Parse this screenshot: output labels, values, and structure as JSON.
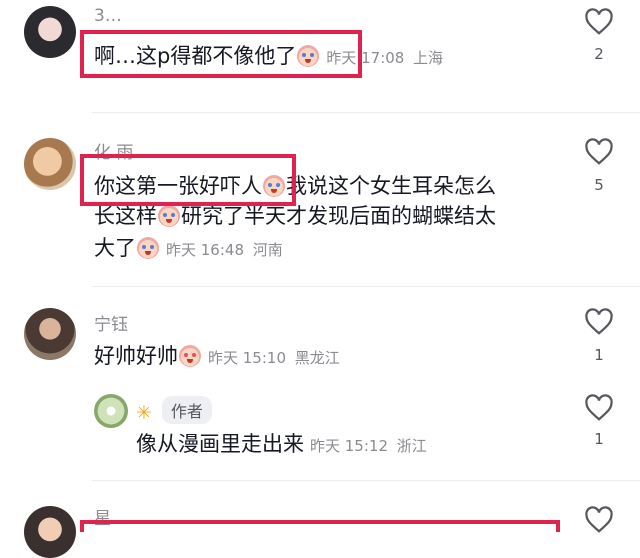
{
  "comments": [
    {
      "author": "3…",
      "text": "啊…这p得都不像他了",
      "time": "昨天 17:08",
      "location": "上海",
      "likes": "2"
    },
    {
      "author": "化 雨",
      "text_line1": "你这第一张好吓人",
      "text_line1b": "我说这个女生耳朵怎么",
      "text_line2a": "长这样",
      "text_line2b": "研究了半天才发现后面的蝴蝶结太",
      "text_line3": "大了",
      "time": "昨天 16:48",
      "location": "河南",
      "likes": "5"
    },
    {
      "author": "宁钰",
      "text": "好帅好帅",
      "time": "昨天 15:10",
      "location": "黑龙江",
      "likes": "1",
      "reply": {
        "author_tag": "作者",
        "text": "像从漫画里走出来",
        "time": "昨天 15:12",
        "location": "浙江",
        "likes": "1"
      }
    },
    {
      "author": "星"
    }
  ],
  "colors": {
    "highlight": "#e0234e",
    "meta": "#8a8b91",
    "text": "#161823"
  },
  "icons": {
    "like": "heart-outline-icon",
    "author_flag": "sun-icon"
  }
}
